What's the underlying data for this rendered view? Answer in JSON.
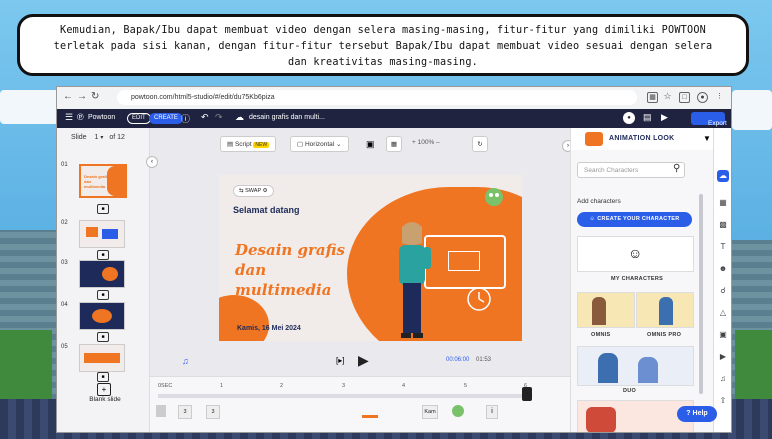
{
  "caption": {
    "line1": "Kemudian, Bapak/Ibu dapat membuat video dengan selera masing-masing, fitur-fitur yang dimiliki POWTOON",
    "line2": "terletak pada sisi kanan, dengan fitur-fitur tersebut Bapak/Ibu dapat membuat video sesuai dengan selera",
    "line3": "dan kreativitas masing-masing."
  },
  "browser": {
    "url": "powtoon.com/html5-studio/#/edit/du75Kb6piza"
  },
  "appbar": {
    "brand": "Powtoon",
    "mode_edit": "EDIT",
    "mode_create": "CREATE",
    "doc_title": "desain grafis dan multi...",
    "export_label": "Export"
  },
  "slides_panel": {
    "label": "Slide",
    "current": "1",
    "of_label": "of 12",
    "numbers": [
      "01",
      "02",
      "03",
      "04",
      "05"
    ],
    "thumb1_lines": [
      "Desain grafis",
      "dan",
      "multimedia"
    ],
    "blank_label": "Blank slide"
  },
  "toolbar": {
    "script_label": "Script",
    "new_badge": "NEW",
    "orientation": "Horizontal",
    "zoom": "100%"
  },
  "slide": {
    "swap_label": "SWAP",
    "greeting": "Selamat datang",
    "title_line1": "Desain grafis",
    "title_line2": "dan",
    "title_line3": "multimedia",
    "date": "Kamis, 16 Mei 2024"
  },
  "player": {
    "time_current": "00:06:00",
    "time_total": "01:53"
  },
  "timeline": {
    "ticks": [
      "0SEC",
      "1",
      "2",
      "3",
      "4",
      "5",
      "6"
    ],
    "labels": [
      "3",
      "3",
      "Kam"
    ]
  },
  "right_panel": {
    "title": "ANIMATION LOOK",
    "search_placeholder": "Search Characters",
    "add_characters": "Add characters",
    "create_button": "CREATE YOUR CHARACTER",
    "my_characters": "MY CHARACTERS",
    "omnis": "OMNIS",
    "omnis_pro": "OMNIS PRO",
    "duo": "DUO",
    "help": "Help"
  },
  "colors": {
    "accent_orange": "#f07522",
    "brand_blue": "#2b5ee8",
    "navy": "#1e2a5a",
    "appbar": "#1f2340"
  }
}
